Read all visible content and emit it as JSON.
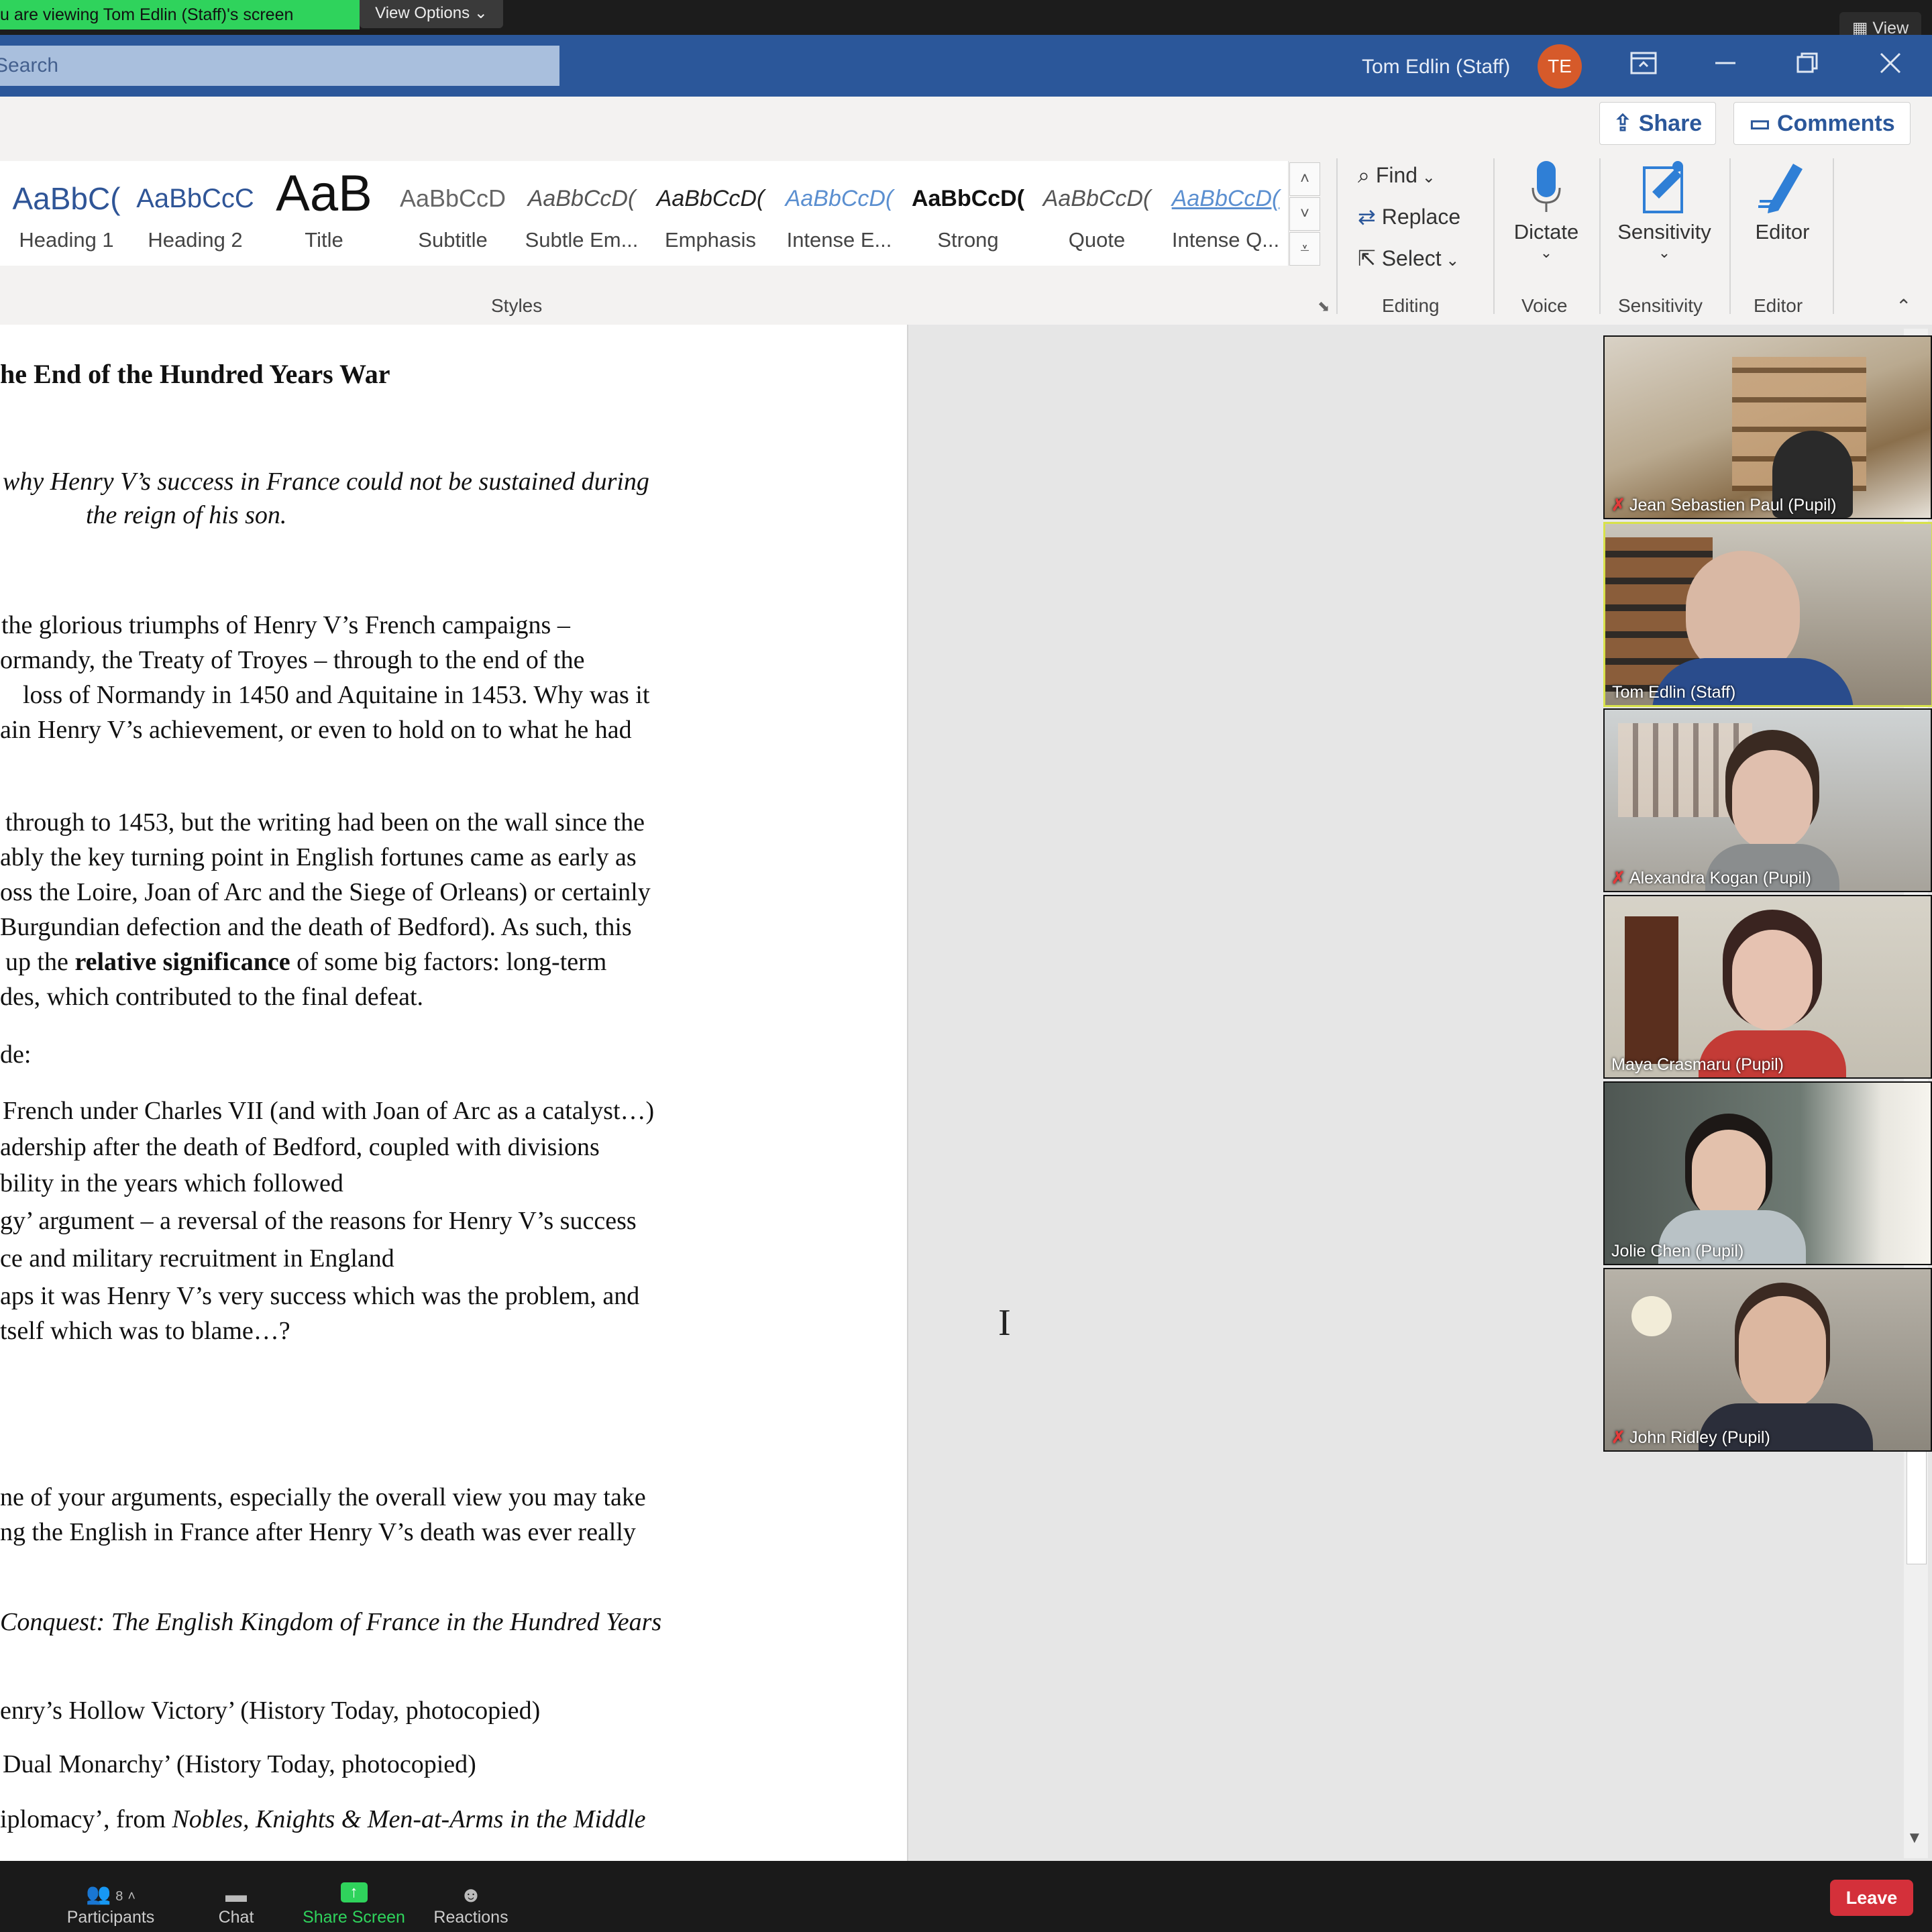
{
  "zoom_top": {
    "share_banner": "u are viewing Tom Edlin (Staff)'s screen",
    "view_options": "View Options ⌄",
    "view_button": "View"
  },
  "word": {
    "search_placeholder": "Search",
    "user_name": "Tom Edlin (Staff)",
    "user_initials": "TE",
    "share_label": "Share",
    "comments_label": "Comments",
    "styles": [
      {
        "sample": "AaBbC(",
        "name": "Heading 1"
      },
      {
        "sample": "AaBbCcC",
        "name": "Heading 2"
      },
      {
        "sample": "AaB",
        "name": "Title"
      },
      {
        "sample": "AaBbCcD",
        "name": "Subtitle"
      },
      {
        "sample": "AaBbCcD(",
        "name": "Subtle Em..."
      },
      {
        "sample": "AaBbCcD(",
        "name": "Emphasis"
      },
      {
        "sample": "AaBbCcD(",
        "name": "Intense E..."
      },
      {
        "sample": "AaBbCcD(",
        "name": "Strong"
      },
      {
        "sample": "AaBbCcD(",
        "name": "Quote"
      },
      {
        "sample": "AaBbCcD(",
        "name": "Intense Q..."
      }
    ],
    "groups": {
      "styles": "Styles",
      "editing": "Editing",
      "voice": "Voice",
      "sensitivity": "Sensitivity",
      "editor": "Editor"
    },
    "editing": {
      "find": "Find",
      "replace": "Replace",
      "select": "Select"
    },
    "dictate": "Dictate",
    "sensitivity": "Sensitivity",
    "editor": "Editor"
  },
  "document": {
    "title": "he End of the Hundred Years War",
    "question_1": "why Henry V’s success in France could not be sustained during",
    "question_2": "the reign of his son.",
    "p1": [
      "the glorious triumphs of Henry V’s French campaigns –",
      "ormandy, the Treaty of Troyes – through to the end of the",
      "loss of Normandy in 1450 and Aquitaine in 1453.  Why was it",
      "ain Henry V’s achievement, or even to hold on to what he had"
    ],
    "p2": [
      "through to 1453, but the writing had been on the wall since the",
      "ably the key turning point in English fortunes came as early as",
      "oss the Loire, Joan of Arc and the Siege of Orleans) or certainly",
      "Burgundian defection and the death of Bedford).  As such, this"
    ],
    "p2_line5_pre": "up the ",
    "p2_line5_bold": "relative significance",
    "p2_line5_post": " of some big factors: long-term",
    "p2_line6": "des, which contributed to the final defeat.",
    "include": "de:",
    "factors": [
      "French under Charles VII (and with Joan of Arc as a catalyst…)",
      "adership after the death of Bedford, coupled with divisions",
      "bility in the years which followed",
      "gy’ argument – a reversal of the reasons for Henry V’s success",
      "ce and military recruitment in England",
      "aps it was Henry V’s very success which was the problem, and",
      "tself which was to blame…?"
    ],
    "conclusion": [
      "ne of your arguments, especially the overall view you may take",
      "ng the English in France after Henry V’s death was ever really"
    ],
    "reading_1": "Conquest: The English Kingdom of France in the Hundred Years",
    "reading_2": "enry’s Hollow Victory’ (History Today, photocopied)",
    "reading_3": "Dual Monarchy’ (History Today, photocopied)",
    "reading_4_pre": "iplomacy’, from ",
    "reading_4_it": "Nobles, Knights & Men-at-Arms in the Middle"
  },
  "participants_video": [
    {
      "name": "Jean Sebastien Paul (Pupil)",
      "muted": true
    },
    {
      "name": "Tom Edlin (Staff)",
      "muted": false
    },
    {
      "name": "Alexandra Kogan (Pupil)",
      "muted": true
    },
    {
      "name": "Maya Crasmaru (Pupil)",
      "muted": false
    },
    {
      "name": "Jolie Chen (Pupil)",
      "muted": false
    },
    {
      "name": "John Ridley (Pupil)",
      "muted": true
    }
  ],
  "zoom_bottom": {
    "participants": "Participants",
    "participant_count": "8",
    "chat": "Chat",
    "share_screen": "Share Screen",
    "reactions": "Reactions",
    "leave": "Leave"
  },
  "colors": {
    "word_blue": "#2b579a",
    "share_green": "#2fd35c",
    "leave_red": "#d4303a"
  }
}
